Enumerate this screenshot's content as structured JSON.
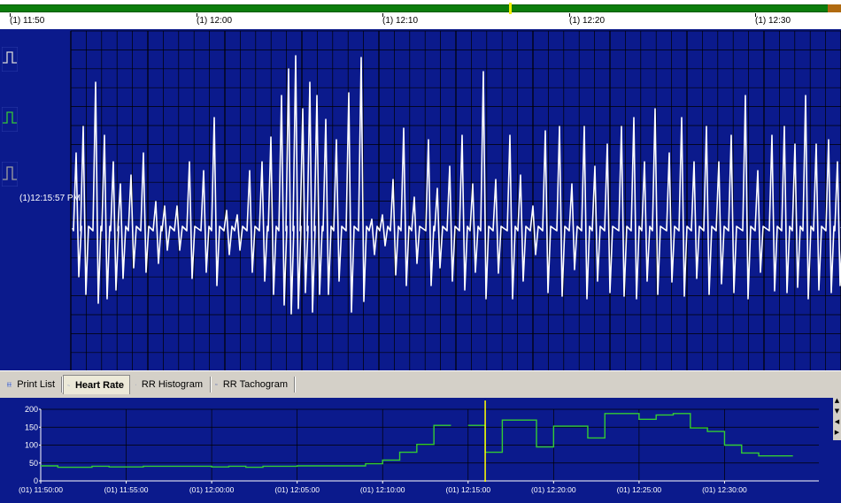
{
  "timeline": {
    "labels": [
      "(1) 11:50",
      "(1) 12:00",
      "(1) 12:10",
      "(1) 12:20",
      "(1) 12:30"
    ],
    "track_color": "#0c7d0c",
    "cursor_color": "#f0f000"
  },
  "ecg": {
    "cursor_time": "(1)12:15:57 PM",
    "trace_color": "#ffffff",
    "grid_color": "#000000",
    "background": "#0b1a8c",
    "channels": [
      {
        "icon": "pulse-white-icon",
        "color": "#d8d8d8"
      },
      {
        "icon": "pulse-green-icon",
        "color": "#36c836"
      },
      {
        "icon": "pulse-gray-icon",
        "color": "#a0a0a0"
      }
    ]
  },
  "tabs": [
    {
      "label": "Print List",
      "icon": "table-grid-icon",
      "active": false
    },
    {
      "label": "Heart Rate",
      "icon": "wave-icon",
      "active": true
    },
    {
      "label": "RR Histogram",
      "icon": "bar-histogram-icon",
      "active": false
    },
    {
      "label": "RR Tachogram",
      "icon": "tachogram-icon",
      "active": false
    }
  ],
  "chart_data": {
    "type": "line",
    "title": "",
    "xlabel": "",
    "ylabel": "",
    "ylim": [
      0,
      200
    ],
    "yticks": [
      "0",
      "50",
      "100",
      "150",
      "200"
    ],
    "x_tick_labels": [
      "(01) 11:50:00",
      "(01) 11:55:00",
      "(01) 12:00:00",
      "(01) 12:05:00",
      "(01) 12:10:00",
      "(01) 12:15:00",
      "(01) 12:20:00",
      "(01) 12:25:00",
      "(01) 12:30:00"
    ],
    "x_unit": "minutes after 11:50:00",
    "xlim": [
      0,
      45
    ],
    "series": [
      {
        "color": "#33cc33",
        "segments": [
          [
            [
              0,
              42
            ],
            [
              1,
              42
            ],
            [
              1,
              38
            ],
            [
              3,
              38
            ],
            [
              3,
              41
            ],
            [
              4,
              41
            ],
            [
              4,
              39
            ],
            [
              6,
              39
            ],
            [
              6,
              41
            ],
            [
              10,
              41
            ],
            [
              10,
              39
            ],
            [
              11,
              39
            ],
            [
              11,
              41
            ],
            [
              12,
              41
            ],
            [
              12,
              38
            ],
            [
              13,
              38
            ],
            [
              13,
              41
            ],
            [
              15,
              41
            ],
            [
              15,
              42
            ],
            [
              19,
              42
            ],
            [
              19,
              48
            ],
            [
              20,
              48
            ],
            [
              20,
              58
            ],
            [
              21,
              58
            ],
            [
              21,
              80
            ],
            [
              22,
              80
            ],
            [
              22,
              102
            ],
            [
              23,
              102
            ],
            [
              23,
              155
            ],
            [
              24,
              155
            ]
          ],
          [
            [
              25,
              155
            ],
            [
              26,
              155
            ],
            [
              26,
              80
            ],
            [
              27,
              80
            ],
            [
              27,
              170
            ],
            [
              29,
              170
            ],
            [
              29,
              95
            ],
            [
              30,
              95
            ],
            [
              30,
              153
            ],
            [
              32,
              153
            ],
            [
              32,
              120
            ],
            [
              33,
              120
            ],
            [
              33,
              188
            ],
            [
              35,
              188
            ],
            [
              35,
              172
            ],
            [
              36,
              172
            ],
            [
              36,
              184
            ],
            [
              37,
              184
            ],
            [
              37,
              188
            ],
            [
              38,
              188
            ],
            [
              38,
              148
            ],
            [
              39,
              148
            ],
            [
              39,
              138
            ],
            [
              40,
              138
            ],
            [
              40,
              100
            ],
            [
              41,
              100
            ],
            [
              41,
              78
            ],
            [
              42,
              78
            ],
            [
              42,
              70
            ],
            [
              44,
              70
            ]
          ]
        ]
      }
    ],
    "cursor_x": 26.0,
    "cursor_color": "#ffff00"
  }
}
